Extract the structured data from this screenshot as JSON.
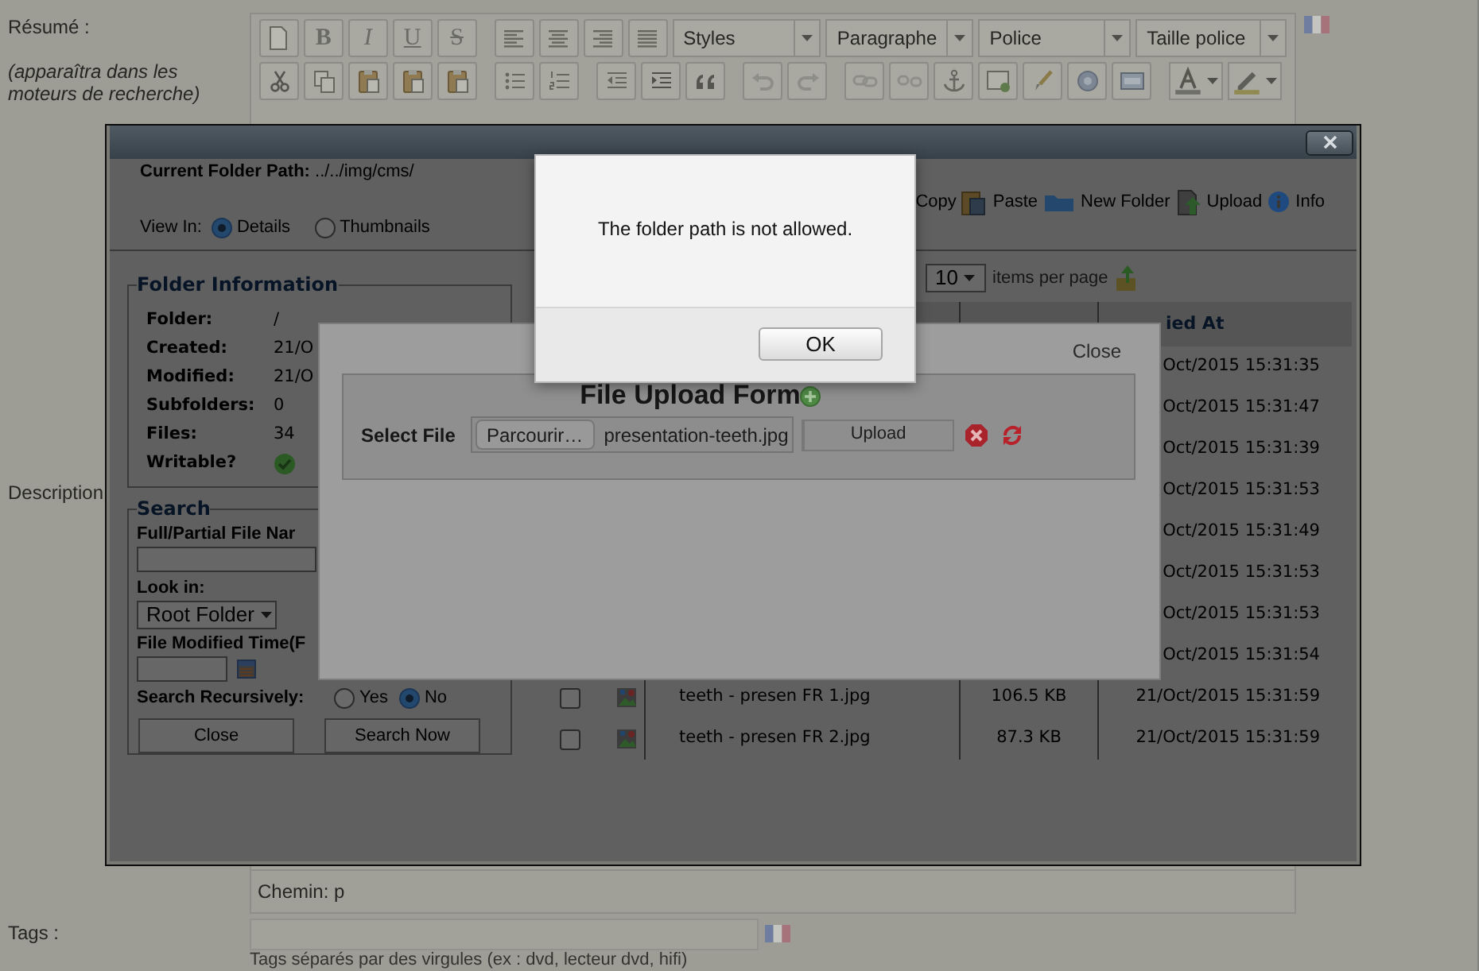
{
  "page": {
    "summary_label": "Résumé :",
    "summary_hint": "(apparaîtra dans les moteurs de recherche)",
    "editor_toolbar": {
      "format_buttons": [
        "B",
        "I",
        "U",
        "S"
      ],
      "dropdowns": [
        "Styles",
        "Paragraphe",
        "Police",
        "Taille police"
      ]
    },
    "description_label": "Description",
    "path_bar": "Chemin: p",
    "tags_label": "Tags :",
    "tags_help": "Tags séparés par des virgules (ex : dvd, lecteur dvd, hifi)"
  },
  "file_manager": {
    "current_folder_label": "Current Folder Path:",
    "current_folder": "../../img/cms/",
    "toolbar": [
      "Copy",
      "Paste",
      "New Folder",
      "Upload",
      "Info"
    ],
    "view_in_label": "View In:",
    "view_options": [
      {
        "label": "Details",
        "selected": true
      },
      {
        "label": "Thumbnails",
        "selected": false
      }
    ],
    "per_page": "10",
    "per_page_label": "items per page",
    "folder_info": {
      "title": "Folder Information",
      "rows": [
        {
          "label": "Folder:",
          "value": "/"
        },
        {
          "label": "Created:",
          "value": "21/O"
        },
        {
          "label": "Modified:",
          "value": "21/O"
        },
        {
          "label": "Subfolders:",
          "value": "0"
        },
        {
          "label": "Files:",
          "value": "34"
        },
        {
          "label": "Writable?",
          "kind": "check"
        }
      ]
    },
    "search": {
      "title": "Search",
      "name_label": "Full/Partial File Nar",
      "look_in_label": "Look in:",
      "look_in": "Root Folder",
      "time_label": "File Modified Time(F",
      "recursive_label": "Search Recursively:",
      "recursive_options": [
        {
          "label": "Yes",
          "selected": false
        },
        {
          "label": "No",
          "selected": true
        }
      ],
      "buttons": [
        "Close",
        "Search Now"
      ]
    },
    "table": {
      "column_4": "ied At",
      "rows": [
        {
          "date": "Oct/2015 15:31:35"
        },
        {
          "date": "Oct/2015 15:31:47"
        },
        {
          "date": "Oct/2015 15:31:39"
        },
        {
          "date": "Oct/2015 15:31:53"
        },
        {
          "date": "Oct/2015 15:31:49"
        },
        {
          "date": "Oct/2015 15:31:53"
        },
        {
          "date": "Oct/2015 15:31:53"
        },
        {
          "date": "Oct/2015 15:31:54"
        },
        {
          "name": "teeth - presen FR 1.jpg",
          "size": "106.5 KB",
          "date": "21/Oct/2015 15:31:59",
          "checked": false
        },
        {
          "name": "teeth - presen FR 2.jpg",
          "size": "87.3 KB",
          "date": "21/Oct/2015 15:31:59",
          "checked": false
        }
      ]
    }
  },
  "upload_dialog": {
    "close": "Close",
    "title": "File Upload Form",
    "select_label": "Select File",
    "browse_button": "Parcourir…",
    "file_name": "presentation-teeth.jpg",
    "upload_button": "Upload"
  },
  "alert": {
    "message": "The folder path is not allowed.",
    "ok_button": "OK"
  }
}
